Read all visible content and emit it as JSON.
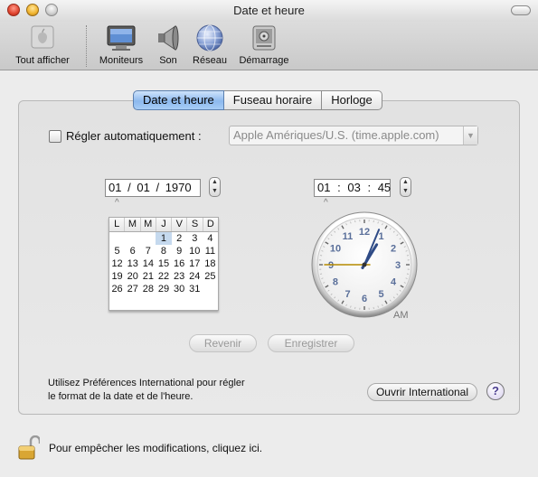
{
  "window": {
    "title": "Date et heure"
  },
  "toolbar": {
    "items": [
      {
        "label": "Tout afficher",
        "icon": "show-all-icon"
      },
      {
        "label": "Moniteurs",
        "icon": "monitor-icon"
      },
      {
        "label": "Son",
        "icon": "speaker-icon"
      },
      {
        "label": "Réseau",
        "icon": "network-globe-icon"
      },
      {
        "label": "Démarrage",
        "icon": "startup-disk-icon"
      }
    ]
  },
  "tabs": [
    {
      "label": "Date et heure",
      "active": true
    },
    {
      "label": "Fuseau horaire",
      "active": false
    },
    {
      "label": "Horloge",
      "active": false
    }
  ],
  "auto_set": {
    "label": "Régler automatiquement :",
    "checked": false,
    "server": "Apple Amériques/U.S. (time.apple.com)"
  },
  "date_field": {
    "month": "01",
    "day": "01",
    "year": "1970",
    "separator": "/"
  },
  "time_field": {
    "hours": "01",
    "minutes": "03",
    "seconds": "45",
    "separator": ":"
  },
  "calendar": {
    "weekdays": [
      "L",
      "M",
      "M",
      "J",
      "V",
      "S",
      "D"
    ],
    "days": [
      "",
      "",
      "",
      "1",
      "2",
      "3",
      "4",
      "5",
      "6",
      "7",
      "8",
      "9",
      "10",
      "11",
      "12",
      "13",
      "14",
      "15",
      "16",
      "17",
      "18",
      "19",
      "20",
      "21",
      "22",
      "23",
      "24",
      "25",
      "26",
      "27",
      "28",
      "29",
      "30",
      "31",
      ""
    ],
    "selected": "1"
  },
  "clock": {
    "numbers": [
      "12",
      "1",
      "2",
      "3",
      "4",
      "5",
      "6",
      "7",
      "8",
      "9",
      "10",
      "11"
    ],
    "hours": 1,
    "minutes": 3,
    "seconds": 45,
    "period": "AM"
  },
  "buttons": {
    "revert": "Revenir",
    "save": "Enregistrer",
    "open_international": "Ouvrir International"
  },
  "info_text": {
    "line1": "Utilisez Préférences International pour régler",
    "line2": "le format de la date et de l'heure."
  },
  "help": {
    "label": "?"
  },
  "lock": {
    "text": "Pour empêcher les modifications, cliquez ici."
  },
  "colors": {
    "tab_active": "#8db9ee",
    "clock_numbers": "#5a6f9a",
    "second_hand": "#b58a00",
    "hour_minute_hands": "#2f4b86"
  }
}
